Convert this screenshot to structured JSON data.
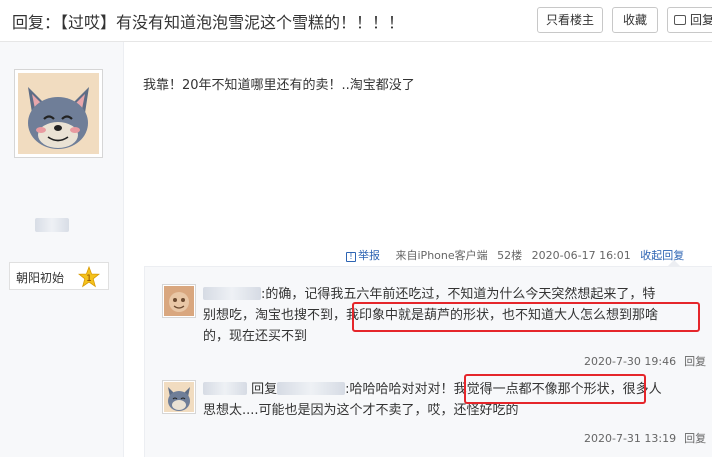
{
  "header": {
    "title": "回复：【过哎】有没有知道泡泡雪泥这个雪糕的！！！！",
    "only_author": "只看楼主",
    "favorite": "收藏",
    "reply": "回复"
  },
  "user": {
    "level_name": "朝阳初始",
    "level_num": "1"
  },
  "post": {
    "content": "我靠！20年不知道哪里还有的卖！..淘宝都没了",
    "report": "举报",
    "source": "来自iPhone客户端",
    "floor": "52楼",
    "time": "2020-06-17 16:01",
    "collapse": "收起回复"
  },
  "replies": [
    {
      "prefix": ":",
      "line1": "的确，记得我五六年前还吃过，不知道为什么今天突然想起来了，特",
      "line2_a": "别想吃，淘宝也搜不到，",
      "line2_hl": "我印象中就是葫芦的形状，也不知道大人怎么想到那啥",
      "line3": "的，现在还买不到",
      "time": "2020-7-30 19:46",
      "reply": "回复"
    },
    {
      "reply_word": "回复",
      "prefix": ":",
      "line1_a": "哈哈哈哈对对对！",
      "line1_hl": "我觉得一点都不像那个形状",
      "line1_b": "，很多人",
      "line2": "思想太....可能也是因为这个才不卖了，哎，还怪好吃的",
      "time": "2020-7-31 13:19",
      "reply": "回复"
    }
  ],
  "colors": {
    "link": "#2d64b3",
    "highlight_box": "#e5262b",
    "reply_bg": "#f7f8fa"
  }
}
